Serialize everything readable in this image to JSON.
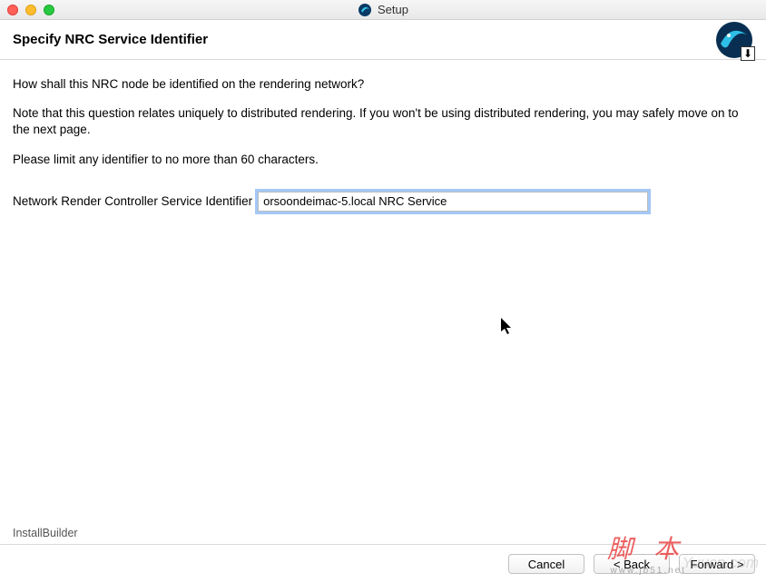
{
  "window": {
    "title": "Setup"
  },
  "header": {
    "title": "Specify NRC Service Identifier"
  },
  "content": {
    "question": "How shall this NRC node be identified on the rendering network?",
    "note": "Note that this question relates uniquely to distributed rendering.  If you won't be using distributed rendering, you may safely move on to the next page.",
    "limit": "Please limit any identifier to no more than 60 characters.",
    "field_label": "Network Render Controller Service Identifier",
    "field_value": "orsoondeimac-5.local NRC Service"
  },
  "footer": {
    "brand": "InstallBuilder",
    "cancel": "Cancel",
    "back": "< Back",
    "forward": "Forward >"
  },
  "watermark": {
    "brand_cn": "脚 本",
    "brand_url": "www.jb51.net",
    "side": "Yuucn.com"
  }
}
